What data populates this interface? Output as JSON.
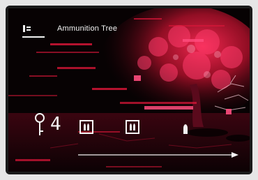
{
  "hud": {
    "title": "Ammunition Tree",
    "menu_icon": "tab-menu-icon",
    "counter_icon": "key-icon",
    "counter_value": "4",
    "slots": [
      {
        "name": "double-round-slot",
        "rounds": 2,
        "boxed": true
      },
      {
        "name": "double-round-slot",
        "rounds": 2,
        "boxed": true
      },
      {
        "name": "single-round-slot",
        "rounds": 1,
        "boxed": false
      }
    ],
    "progress_arrow": "arrow-right-icon"
  },
  "palette": {
    "background": "#050102",
    "accent_red": "#e0173a",
    "hot_pink": "#ff3d7f",
    "hud_white": "#f4f4f4"
  }
}
